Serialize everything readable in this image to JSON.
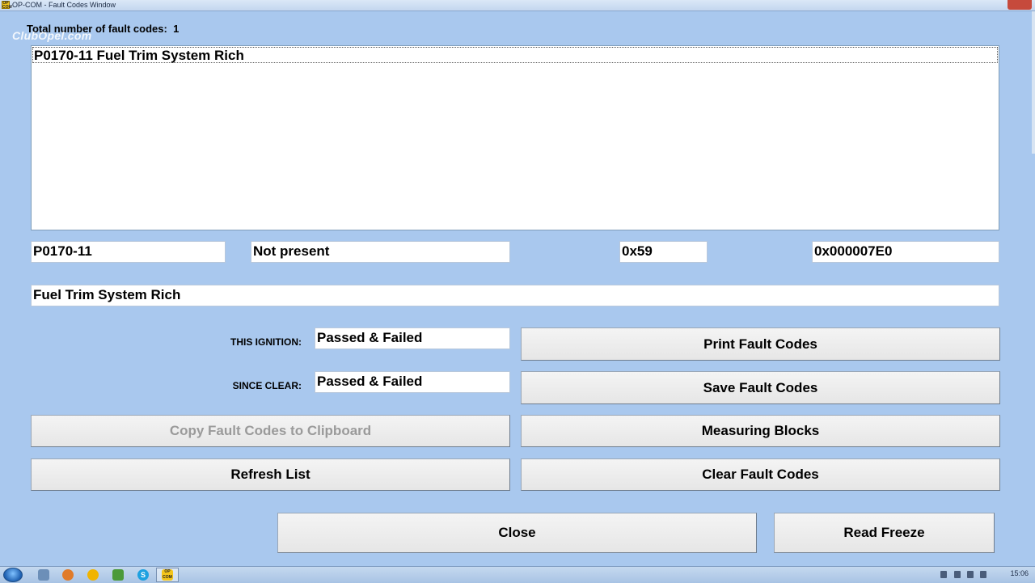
{
  "window": {
    "title": "OP-COM - Fault Codes Window",
    "app_icon": "OP COM"
  },
  "watermark": "ClubOpel.com",
  "summary": {
    "total_label": "Total number of fault codes:",
    "total_count": "1"
  },
  "fault_list": {
    "items": [
      "P0170-11 Fuel Trim System Rich"
    ]
  },
  "detail": {
    "code": "P0170-11",
    "status": "Not present",
    "hex_code": "0x59",
    "address": "0x000007E0",
    "description": "Fuel Trim System Rich",
    "this_ignition_label": "THIS IGNITION:",
    "this_ignition_value": "Passed & Failed",
    "since_clear_label": "SINCE CLEAR:",
    "since_clear_value": "Passed & Failed"
  },
  "buttons": {
    "print": "Print Fault Codes",
    "save": "Save Fault Codes",
    "copy": "Copy Fault Codes to Clipboard",
    "measuring": "Measuring Blocks",
    "refresh": "Refresh List",
    "clear": "Clear Fault Codes",
    "close": "Close",
    "read_freeze": "Read Freeze"
  },
  "taskbar": {
    "clock": "15:06",
    "active_app": "OP COM"
  },
  "colors": {
    "background": "#a9c8ee",
    "disabled_text": "#9a9a9a"
  }
}
